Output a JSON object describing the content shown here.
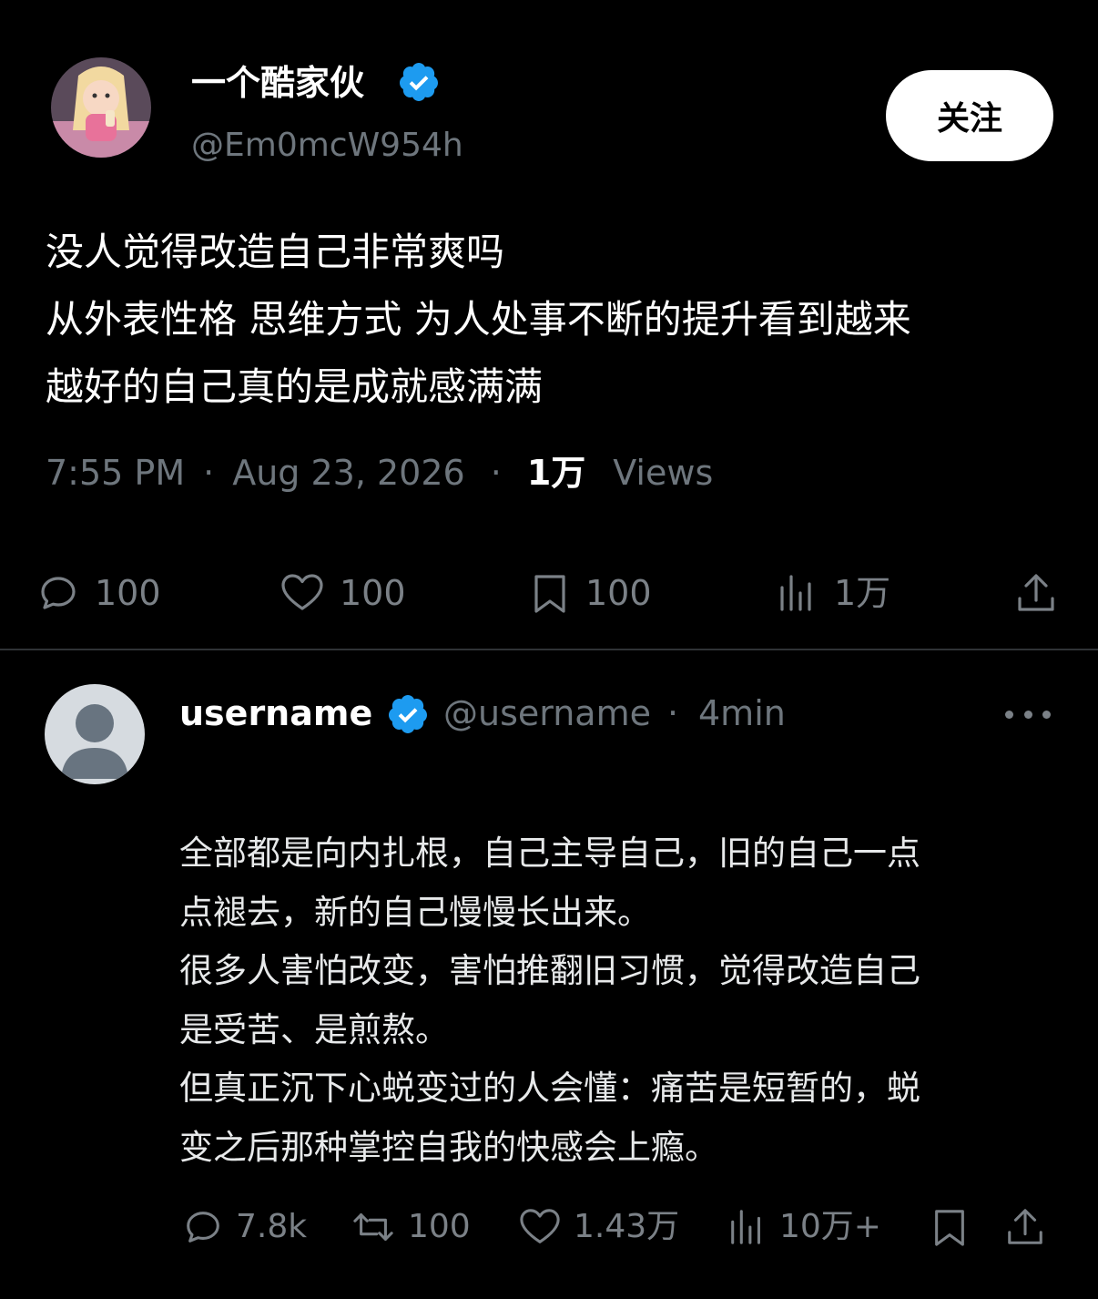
{
  "post": {
    "display_name": "一个酷家伙",
    "handle": "@Em0mcW954h",
    "follow_label": "关注",
    "text_lines": [
      "没人觉得改造自己非常爽吗",
      "从外表性格 思维方式 为人处事不断的提升看到越来",
      "越好的自己真的是成就感满满"
    ],
    "time": "7:55 PM",
    "date": "Aug 23, 2026",
    "views_count": "1万",
    "views_label": "Views",
    "actions": {
      "replies": "100",
      "likes": "100",
      "bookmarks": "100",
      "views": "1万"
    }
  },
  "reply": {
    "name": "username",
    "handle": "@username",
    "separator": "·",
    "time": "4min",
    "text_lines": [
      "全部都是向内扎根，自己主导自己，旧的自己一点",
      "点褪去，新的自己慢慢长出来。",
      "很多人害怕改变，害怕推翻旧习惯，觉得改造自己",
      "是受苦、是煎熬。",
      "但真正沉下心蜕变过的人会懂：痛苦是短暂的，蜕",
      "变之后那种掌控自我的快感会上瘾。"
    ],
    "actions": {
      "replies": "7.8k",
      "reposts": "100",
      "likes": "1.43万",
      "views": "10万+"
    }
  },
  "icons": {
    "verified": "verified-badge-icon",
    "reply": "reply-bubble-icon",
    "like": "heart-icon",
    "bookmark": "bookmark-icon",
    "views": "bar-chart-icon",
    "share": "share-icon",
    "repost": "repost-icon",
    "more": "more-dots-icon"
  },
  "colors": {
    "background": "#000000",
    "verified_blue": "#1d9bf0",
    "muted_text": "#6e767d",
    "divider": "#2f3336"
  }
}
